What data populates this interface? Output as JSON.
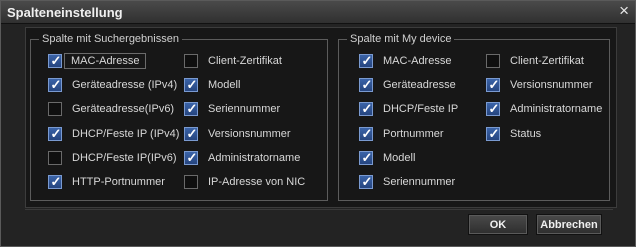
{
  "window": {
    "title": "Spalteneinstellung",
    "close_icon": "×"
  },
  "left_group": {
    "legend": "Spalte mit Suchergebnissen",
    "col1": [
      {
        "label": "MAC-Adresse",
        "checked": true
      },
      {
        "label": "Geräteadresse (IPv4)",
        "checked": true
      },
      {
        "label": "Geräteadresse(IPv6)",
        "checked": false
      },
      {
        "label": "DHCP/Feste IP (IPv4)",
        "checked": true
      },
      {
        "label": "DHCP/Feste IP(IPv6)",
        "checked": false
      },
      {
        "label": "HTTP-Portnummer",
        "checked": true
      }
    ],
    "col2": [
      {
        "label": "Client-Zertifikat",
        "checked": false
      },
      {
        "label": "Modell",
        "checked": true
      },
      {
        "label": "Seriennummer",
        "checked": true
      },
      {
        "label": "Versionsnummer",
        "checked": true
      },
      {
        "label": "Administratorname",
        "checked": true
      },
      {
        "label": "IP-Adresse von NIC",
        "checked": false
      }
    ]
  },
  "right_group": {
    "legend": "Spalte mit My device",
    "col1": [
      {
        "label": "MAC-Adresse",
        "checked": true
      },
      {
        "label": "Geräteadresse",
        "checked": true
      },
      {
        "label": "DHCP/Feste IP",
        "checked": true
      },
      {
        "label": "Portnummer",
        "checked": true
      },
      {
        "label": "Modell",
        "checked": true
      },
      {
        "label": "Seriennummer",
        "checked": true
      }
    ],
    "col2": [
      {
        "label": "Client-Zertifikat",
        "checked": false
      },
      {
        "label": "Versionsnummer",
        "checked": true
      },
      {
        "label": "Administratorname",
        "checked": true
      },
      {
        "label": "Status",
        "checked": true
      }
    ]
  },
  "buttons": {
    "ok": "OK",
    "cancel": "Abbrechen"
  }
}
